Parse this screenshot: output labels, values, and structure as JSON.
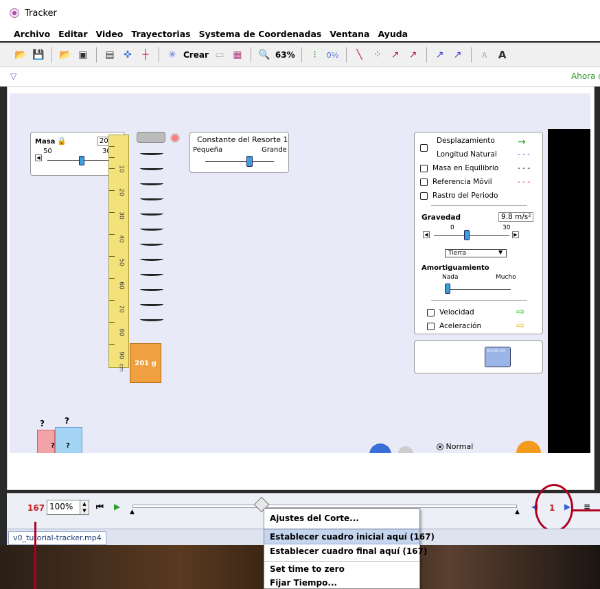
{
  "window": {
    "title": "Tracker"
  },
  "menu": [
    "Archivo",
    "Editar",
    "Video",
    "Trayectorias",
    "Systema de Coordenadas",
    "Ventana",
    "Ayuda"
  ],
  "toolbar": {
    "create_label": "Crear",
    "zoom_label": "63%"
  },
  "info": {
    "status_text": "Ahora d"
  },
  "sim": {
    "masa_label": "Masa",
    "masa_value": "201 g",
    "masa_min": "50",
    "masa_max": "300",
    "resorte_title": "Constante del Resorte 1",
    "resorte_min": "Pequeña",
    "resorte_max": "Grande",
    "options": [
      "Desplazamiento",
      "Longitud Natural",
      "Masa en Equilibrio",
      "Referencia Móvil",
      "Rastro del Periodo"
    ],
    "gravedad_label": "Gravedad",
    "gravedad_value": "9.8 m/s²",
    "gravedad_min": "0",
    "gravedad_max": "30",
    "planet": "Tierra",
    "amortiguamiento_label": "Amortiguamiento",
    "amort_min": "Nada",
    "amort_max": "Mucho",
    "velocidad_label": "Velocidad",
    "aceleracion_label": "Aceleración",
    "timer_text": "00:00.00",
    "weight_label": "201 g",
    "ruler_unit": "cm",
    "ruler_numbers": [
      "10",
      "20",
      "30",
      "40",
      "50",
      "60",
      "70",
      "80",
      "90"
    ],
    "mystery": "?",
    "normal_label": "Normal"
  },
  "player": {
    "current_frame": "167",
    "zoom": "100%",
    "end_frame": "1"
  },
  "tab": {
    "filename": "v0_tutorial-tracker.mp4"
  },
  "context_menu": {
    "items": [
      "Ajustes del Corte...",
      "Establecer cuadro inicial aquí (167)",
      "Establecer cuadro final aquí (167)",
      "Set time to zero",
      "Fijar Tiempo..."
    ]
  }
}
